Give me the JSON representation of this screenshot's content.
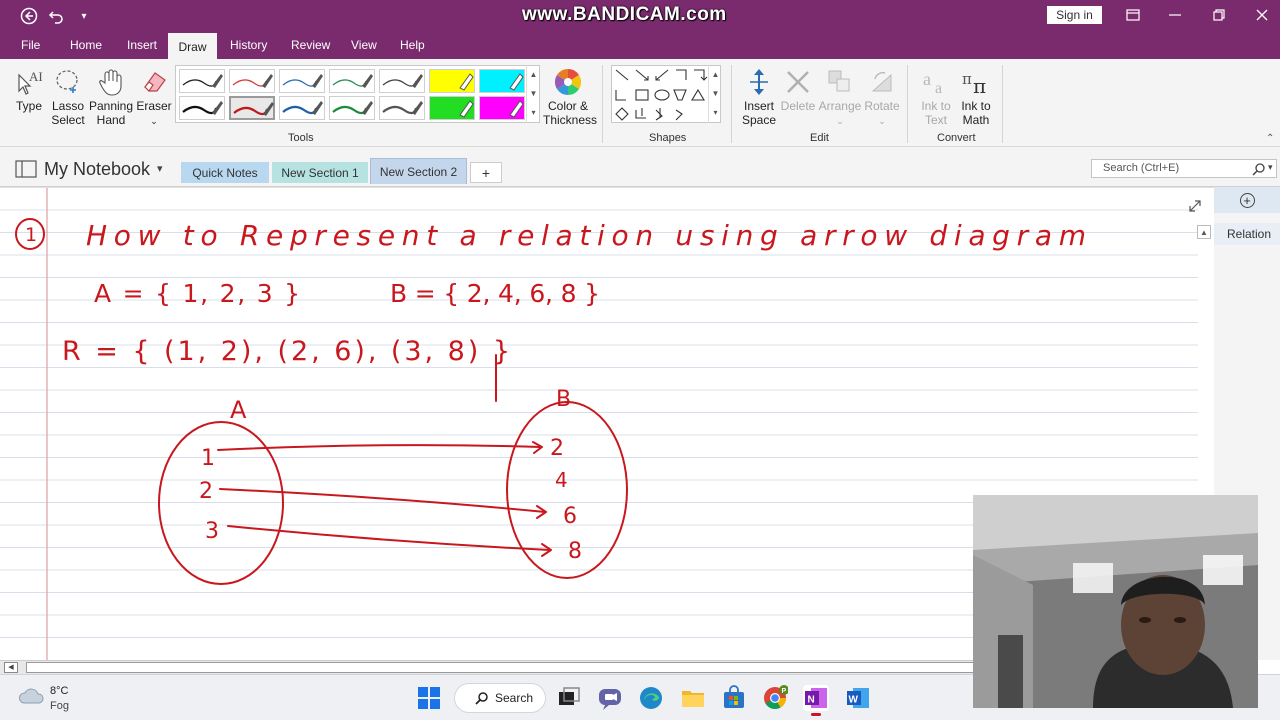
{
  "titlebar": {
    "watermark": "www.BANDICAM.com",
    "signin_label": "Sign in"
  },
  "ribbon_tabs": [
    "File",
    "Home",
    "Insert",
    "Draw",
    "History",
    "Review",
    "View",
    "Help"
  ],
  "active_tab": "Draw",
  "ribbon": {
    "type_label": "Type",
    "lasso_line1": "Lasso",
    "lasso_line2": "Select",
    "panning_line1": "Panning",
    "panning_line2": "Hand",
    "eraser_label": "Eraser",
    "tools_group": "Tools",
    "color_line1": "Color &",
    "color_line2": "Thickness",
    "shapes_group": "Shapes",
    "insert_space_line1": "Insert",
    "insert_space_line2": "Space",
    "delete_label": "Delete",
    "arrange_label": "Arrange",
    "rotate_label": "Rotate",
    "edit_group": "Edit",
    "ink_text_line1": "Ink to",
    "ink_text_line2": "Text",
    "ink_math_line1": "Ink to",
    "ink_math_line2": "Math",
    "convert_group": "Convert",
    "pen_colors": [
      "#222222",
      "#d63b3b",
      "#2f6fb0",
      "#2e8b57",
      "#444444",
      "#ffff00",
      "#00f0ff",
      "#111111",
      "#c0171b",
      "#1f5fa6",
      "#1a8c3a",
      "#555555",
      "#22dd22",
      "#ff00ff"
    ]
  },
  "notebook": {
    "name": "My Notebook",
    "sections": [
      "Quick Notes",
      "New Section 1",
      "New Section 2"
    ],
    "active_section": "New Section 2",
    "add_section": "+",
    "search_placeholder": "Search (Ctrl+E)"
  },
  "right_panel": {
    "add_page": "+",
    "page_title": "Relation"
  },
  "note": {
    "number": "1",
    "heading": "How to Represent a relation using arrow diagram",
    "set_a": "A = { 1, 2, 3 }",
    "set_b": "B = { 2, 4, 6, 8 }",
    "relation": "R = { (1, 2), (2, 6), (3, 8) }",
    "label_a": "A",
    "label_b": "B",
    "domain": [
      "1",
      "2",
      "3"
    ],
    "codomain": [
      "2",
      "4",
      "6",
      "8"
    ]
  },
  "taskbar": {
    "temperature": "8°C",
    "weather": "Fog",
    "search_label": "Search"
  }
}
